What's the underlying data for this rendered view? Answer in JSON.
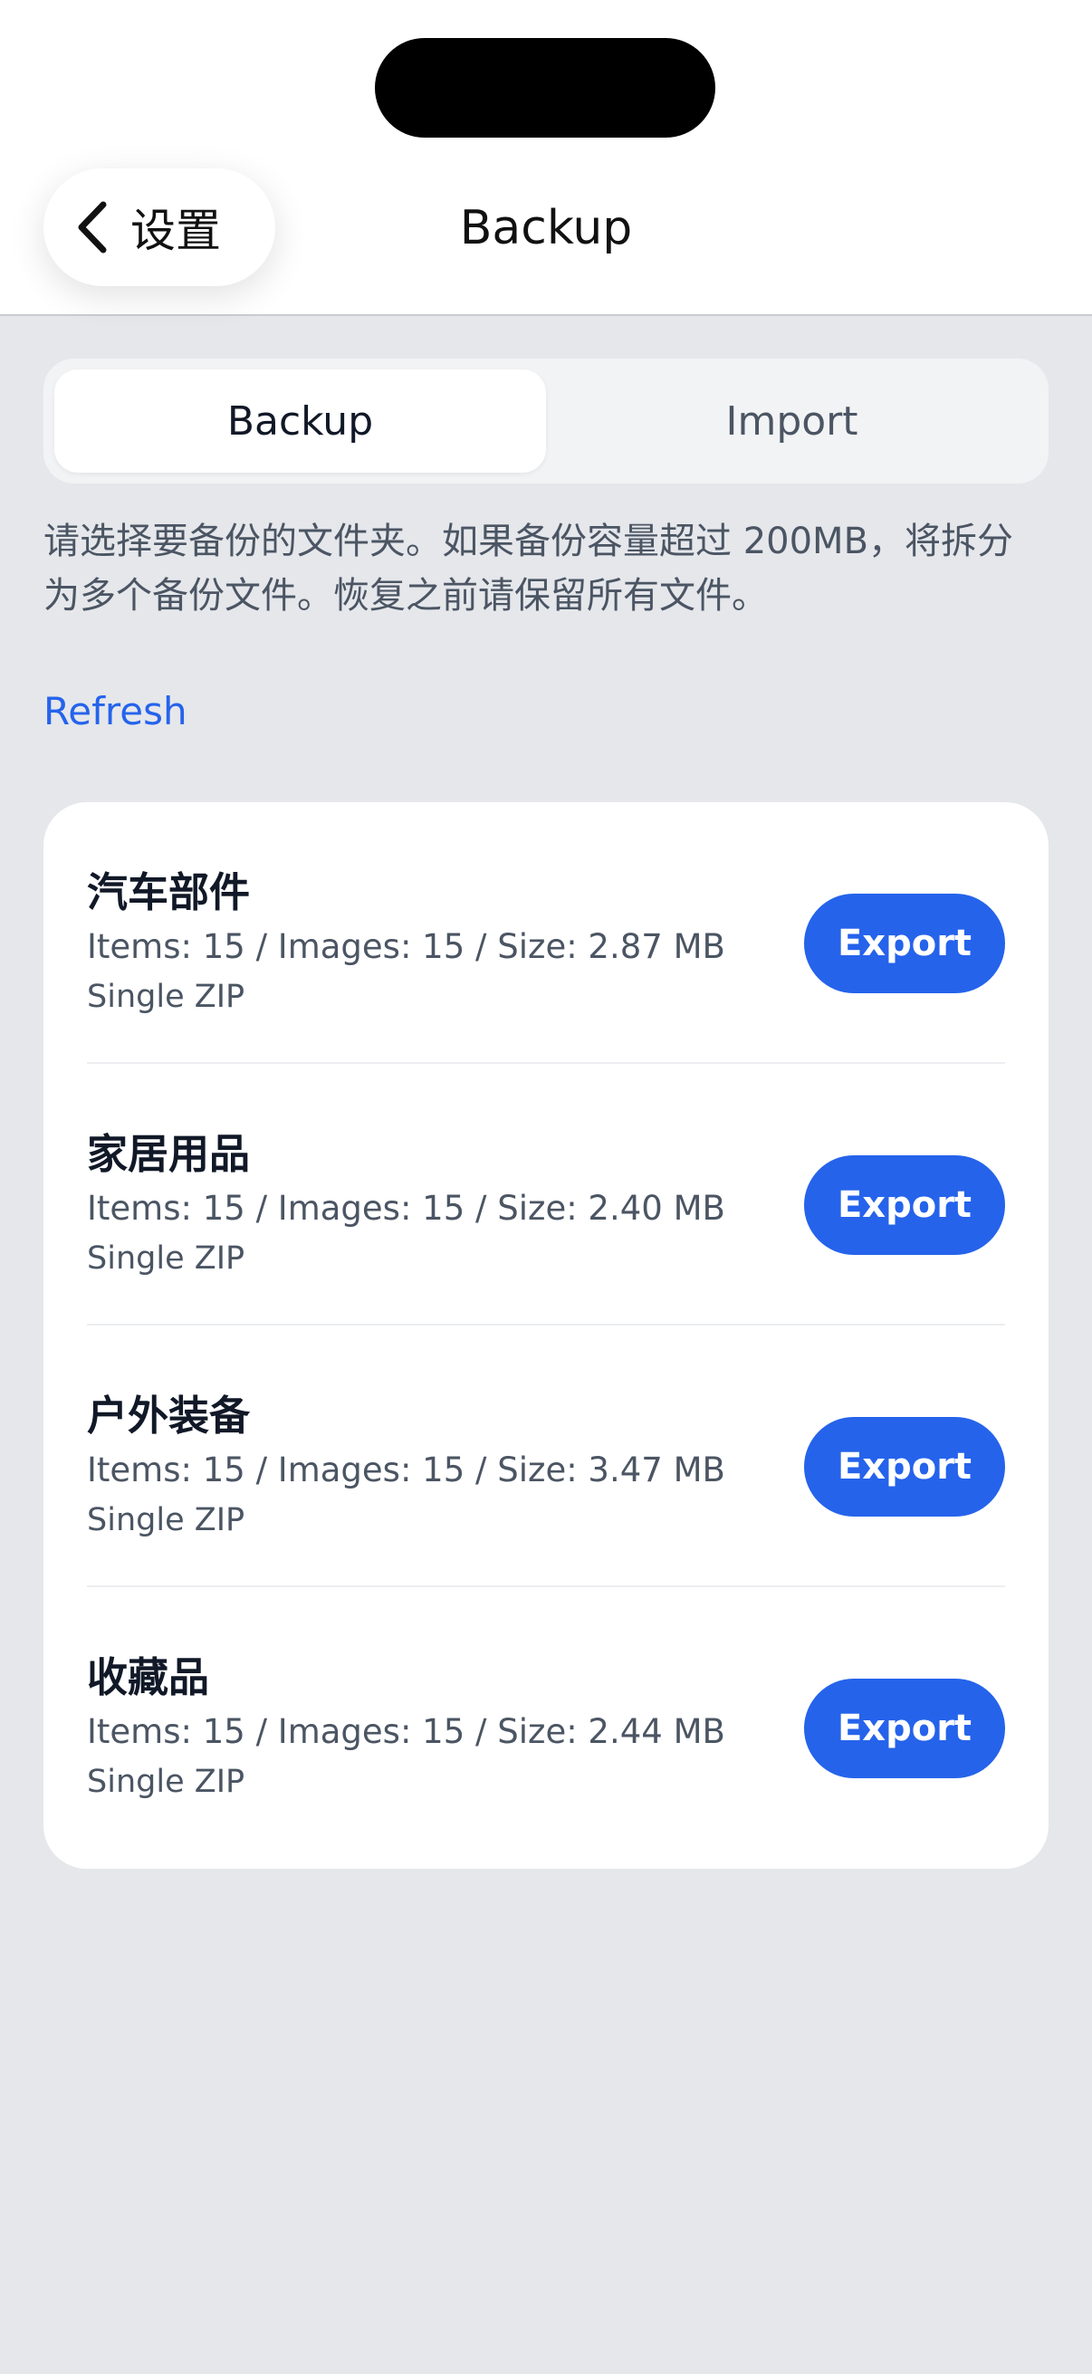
{
  "nav": {
    "back_label": "设置",
    "title": "Backup"
  },
  "tabs": [
    {
      "label": "Backup",
      "active": true
    },
    {
      "label": "Import",
      "active": false
    }
  ],
  "description": "请选择要备份的文件夹。如果备份容量超过 200MB，将拆分为多个备份文件。恢复之前请保留所有文件。",
  "refresh_label": "Refresh",
  "folders": [
    {
      "name": "汽车部件",
      "meta": "Items: 15 / Images: 15 / Size: 2.87 MB",
      "mode": "Single ZIP",
      "action": "Export"
    },
    {
      "name": "家居用品",
      "meta": "Items: 15 / Images: 15 / Size: 2.40 MB",
      "mode": "Single ZIP",
      "action": "Export"
    },
    {
      "name": "户外装备",
      "meta": "Items: 15 / Images: 15 / Size: 3.47 MB",
      "mode": "Single ZIP",
      "action": "Export"
    },
    {
      "name": "收藏品",
      "meta": "Items: 15 / Images: 15 / Size: 2.44 MB",
      "mode": "Single ZIP",
      "action": "Export"
    }
  ],
  "colors": {
    "accent": "#2563eb",
    "background": "#e5e7eb",
    "card": "#ffffff"
  }
}
